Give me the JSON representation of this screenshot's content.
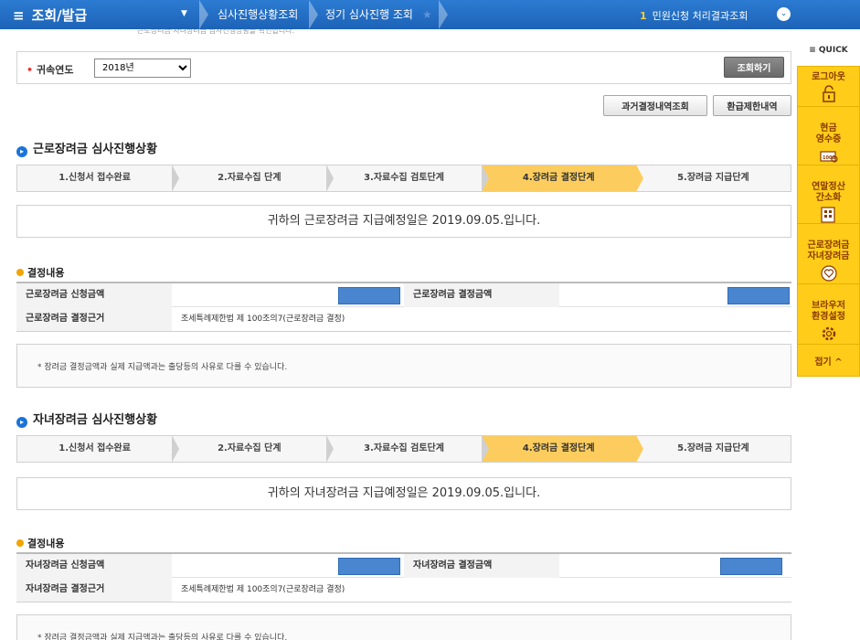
{
  "nav": {
    "menu_label": "조회/발급",
    "crumbs": [
      "심사진행상황조회",
      "정기 심사진행 조회"
    ],
    "civil_count": "1",
    "civil_label": "민원신청 처리결과조회",
    "faint_text": "근로장려금·자녀장려금 심사진행상황을 확인합니다."
  },
  "quick": {
    "head": "QUICK",
    "items": [
      "로그아웃",
      "현금\n영수증",
      "연말정산\n간소화",
      "근로장려금\n자녀장려금",
      "브라우저\n환경설정"
    ],
    "fold": "접기"
  },
  "year": {
    "label": "귀속연도",
    "selected": "2018년",
    "query_button": "조회하기"
  },
  "buttons": {
    "past": "과거결정내역조회",
    "refund": "환급제한내역"
  },
  "steps": [
    "1.신청서 접수완료",
    "2.자료수집 단계",
    "3.자료수집 검토단계",
    "4.장려금 결정단계",
    "5.장려금 지급단계"
  ],
  "active_step": 3,
  "sections": [
    {
      "title": "근로장려금 심사진행상황",
      "notice": "귀하의 근로장려금 지급예정일은 2019.09.05.입니다.",
      "result_title": "결정내용",
      "apply_label": "근로장려금 신청금액",
      "decision_label": "근로장려금 결정금액",
      "basis_label": "근로장려금 결정근거",
      "basis_value": "조세특례제한법 제 100조의7(근로장려금 결정)",
      "footnote": "* 장려금 결정금액과 실제 지급액과는 출당등의 사유로 다를 수 있습니다."
    },
    {
      "title": "자녀장려금 심사진행상황",
      "notice": "귀하의 자녀장려금 지급예정일은 2019.09.05.입니다.",
      "result_title": "결정내용",
      "apply_label": "자녀장려금 신청금액",
      "decision_label": "자녀장려금 결정금액",
      "basis_label": "자녀장려금 결정근거",
      "basis_value": "조세특례제한법 제 100조의7(근로장려금 결정)",
      "footnote": "* 장려금 결정금액과 실제 지급액과는 출당등의 사유로 다를 수 있습니다."
    }
  ],
  "colors": {
    "nav": "#1c63b7",
    "quick": "#ffcc1a",
    "active_step": "#fccd5e",
    "masked": "#4a86cf"
  }
}
